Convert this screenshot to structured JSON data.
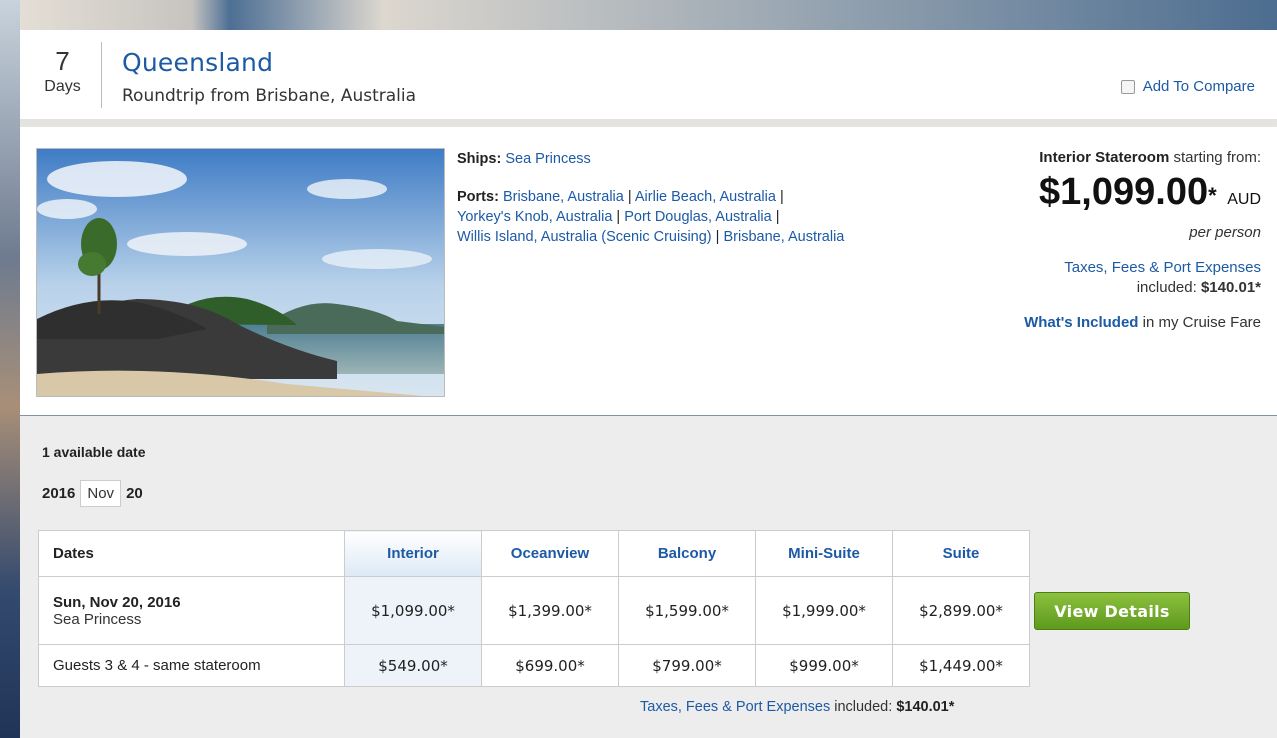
{
  "header": {
    "days_num": "7",
    "days_label": "Days",
    "title": "Queensland",
    "subtitle": "Roundtrip from Brisbane, Australia",
    "compare_label": "Add To Compare"
  },
  "details": {
    "ships_label": "Ships:",
    "ship_name": "Sea Princess",
    "ports_label": "Ports:",
    "port1": "Brisbane, Australia",
    "port2": "Airlie Beach, Australia",
    "port3": "Yorkey's Knob, Australia",
    "port4": "Port Douglas, Australia",
    "port5": "Willis Island, Australia (Scenic Cruising)",
    "port6": "Brisbane, Australia",
    "sep": " | "
  },
  "price": {
    "stateroom": "Interior Stateroom",
    "starting": " starting from:",
    "amount": "$1,099.00",
    "star": "*",
    "currency": "AUD",
    "per_person": "per person",
    "tax_link": "Taxes, Fees & Port Expenses",
    "tax_included_label": "included: ",
    "tax_amount": "$140.01*",
    "whats_included_link": "What's Included",
    "whats_included_rest": " in my Cruise Fare"
  },
  "dates": {
    "available": "1 available date",
    "year": "2016",
    "month": "Nov",
    "day": "20"
  },
  "table": {
    "headers": [
      "Dates",
      "Interior",
      "Oceanview",
      "Balcony",
      "Mini-Suite",
      "Suite"
    ],
    "row1": {
      "date": "Sun, Nov 20, 2016",
      "ship": "Sea Princess",
      "prices": [
        "$1,099.00*",
        "$1,399.00*",
        "$1,599.00*",
        "$1,999.00*",
        "$2,899.00*"
      ]
    },
    "row2": {
      "label": "Guests 3 & 4 - same stateroom",
      "prices": [
        "$549.00*",
        "$699.00*",
        "$799.00*",
        "$999.00*",
        "$1,449.00*"
      ]
    },
    "view_details": "View Details"
  },
  "footer": {
    "tax_link": "Taxes, Fees & Port Expenses",
    "included": " included: ",
    "amount": "$140.01*"
  }
}
